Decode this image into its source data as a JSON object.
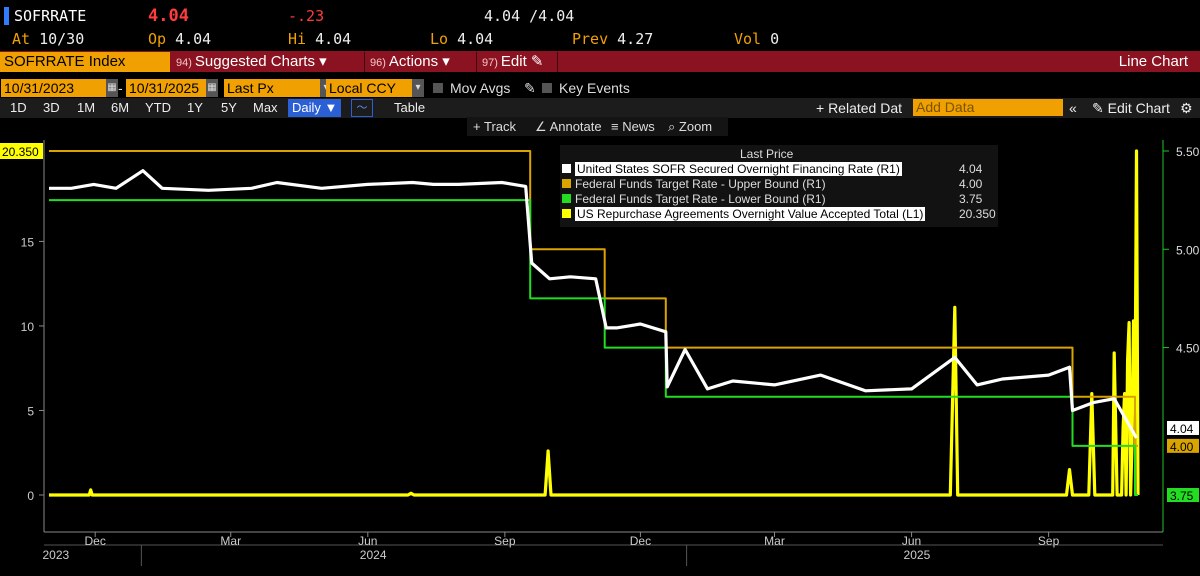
{
  "quote": {
    "ticker": "SOFRRATE",
    "last": "4.04",
    "change": "-.23",
    "bid_ask": "4.04 /4.04",
    "at_label": "At",
    "at_value": "10/30",
    "open_label": "Op",
    "open_value": "4.04",
    "high_label": "Hi",
    "high_value": "4.04",
    "low_label": "Lo",
    "low_value": "4.04",
    "prev_label": "Prev",
    "prev_value": "4.27",
    "vol_label": "Vol",
    "vol_value": "0"
  },
  "menu": {
    "title": "SOFRRATE Index",
    "items": [
      {
        "num": "94)",
        "label": "Suggested Charts ▾"
      },
      {
        "num": "96)",
        "label": "Actions ▾"
      },
      {
        "num": "97)",
        "label": "Edit ✎"
      }
    ],
    "right": "Line Chart"
  },
  "range": {
    "start": "10/31/2023",
    "dash": "-",
    "end": "10/31/2025",
    "field": "Last Px",
    "currency": "Local CCY",
    "mov_avgs": "Mov Avgs",
    "key_events": "Key Events"
  },
  "periods": [
    "1D",
    "3D",
    "1M",
    "6M",
    "YTD",
    "1Y",
    "5Y",
    "Max"
  ],
  "frequency": "Daily ▼",
  "table_btn": "Table",
  "related_data": "+ Related Dat",
  "add_data_placeholder": "Add Data",
  "edit_chart": "✎ Edit Chart",
  "tools": [
    "Track",
    "Annotate",
    "News",
    "Zoom"
  ],
  "colors": {
    "sofr": "#ffffff",
    "upper": "#d9a400",
    "lower": "#22dd22",
    "repo": "#ffff00",
    "accent": "#f0a000",
    "menu_bg": "#8b1220"
  },
  "chart_data": {
    "type": "line",
    "legend_title": "Last Price",
    "legend_position": "top-center",
    "series": [
      {
        "name": "United States SOFR Secured Overnight Financing Rate  (R1)",
        "axis": "right",
        "last_label": "4.04",
        "points": [
          [
            "2023-10-31",
            5.31
          ],
          [
            "2023-11-15",
            5.31
          ],
          [
            "2023-11-30",
            5.33
          ],
          [
            "2023-12-15",
            5.31
          ],
          [
            "2024-01-02",
            5.4
          ],
          [
            "2024-01-15",
            5.31
          ],
          [
            "2024-02-15",
            5.3
          ],
          [
            "2024-03-15",
            5.31
          ],
          [
            "2024-04-01",
            5.34
          ],
          [
            "2024-05-01",
            5.31
          ],
          [
            "2024-06-01",
            5.33
          ],
          [
            "2024-07-01",
            5.34
          ],
          [
            "2024-07-15",
            5.33
          ],
          [
            "2024-08-01",
            5.33
          ],
          [
            "2024-08-30",
            5.34
          ],
          [
            "2024-09-15",
            5.32
          ],
          [
            "2024-09-19",
            4.93
          ],
          [
            "2024-10-01",
            4.85
          ],
          [
            "2024-10-15",
            4.86
          ],
          [
            "2024-11-01",
            4.85
          ],
          [
            "2024-11-08",
            4.6
          ],
          [
            "2024-11-15",
            4.6
          ],
          [
            "2024-12-01",
            4.62
          ],
          [
            "2024-12-18",
            4.58
          ],
          [
            "2024-12-19",
            4.3
          ],
          [
            "2024-12-31",
            4.49
          ],
          [
            "2025-01-15",
            4.29
          ],
          [
            "2025-02-01",
            4.33
          ],
          [
            "2025-03-01",
            4.31
          ],
          [
            "2025-04-01",
            4.36
          ],
          [
            "2025-05-01",
            4.28
          ],
          [
            "2025-06-01",
            4.29
          ],
          [
            "2025-06-30",
            4.45
          ],
          [
            "2025-07-15",
            4.31
          ],
          [
            "2025-08-01",
            4.34
          ],
          [
            "2025-09-01",
            4.36
          ],
          [
            "2025-09-15",
            4.4
          ],
          [
            "2025-09-17",
            4.18
          ],
          [
            "2025-10-01",
            4.22
          ],
          [
            "2025-10-15",
            4.24
          ],
          [
            "2025-10-30",
            4.04
          ]
        ]
      },
      {
        "name": "Federal Funds Target Rate - Upper Bound  (R1)",
        "axis": "right",
        "last_label": "4.00",
        "points": [
          [
            "2023-10-31",
            5.5
          ],
          [
            "2024-09-18",
            5.5
          ],
          [
            "2024-09-18",
            5.0
          ],
          [
            "2024-11-07",
            5.0
          ],
          [
            "2024-11-07",
            4.75
          ],
          [
            "2024-12-18",
            4.75
          ],
          [
            "2024-12-18",
            4.5
          ],
          [
            "2025-09-17",
            4.5
          ],
          [
            "2025-09-17",
            4.25
          ],
          [
            "2025-10-29",
            4.25
          ],
          [
            "2025-10-29",
            4.0
          ],
          [
            "2025-10-31",
            4.0
          ]
        ]
      },
      {
        "name": "Federal Funds Target Rate - Lower Bound  (R1)",
        "axis": "right",
        "last_label": "3.75",
        "points": [
          [
            "2023-10-31",
            5.25
          ],
          [
            "2024-09-18",
            5.25
          ],
          [
            "2024-09-18",
            4.75
          ],
          [
            "2024-11-07",
            4.75
          ],
          [
            "2024-11-07",
            4.5
          ],
          [
            "2024-12-18",
            4.5
          ],
          [
            "2024-12-18",
            4.25
          ],
          [
            "2025-09-17",
            4.25
          ],
          [
            "2025-09-17",
            4.0
          ],
          [
            "2025-10-29",
            4.0
          ],
          [
            "2025-10-29",
            3.75
          ],
          [
            "2025-10-31",
            3.75
          ]
        ]
      },
      {
        "name": "US Repurchase Agreements Overnight Value Accepted Total  (L1)",
        "axis": "left",
        "last_label": "20.350",
        "points": [
          [
            "2023-10-31",
            0
          ],
          [
            "2023-11-27",
            0
          ],
          [
            "2023-11-28",
            0.3
          ],
          [
            "2023-11-29",
            0
          ],
          [
            "2024-06-28",
            0
          ],
          [
            "2024-06-30",
            0.1
          ],
          [
            "2024-07-02",
            0
          ],
          [
            "2024-09-28",
            0
          ],
          [
            "2024-09-30",
            2.6
          ],
          [
            "2024-10-02",
            0
          ],
          [
            "2025-06-27",
            0
          ],
          [
            "2025-06-30",
            11.1
          ],
          [
            "2025-07-02",
            0
          ],
          [
            "2025-09-13",
            0
          ],
          [
            "2025-09-15",
            1.5
          ],
          [
            "2025-09-17",
            0
          ],
          [
            "2025-09-28",
            0
          ],
          [
            "2025-09-30",
            6.0
          ],
          [
            "2025-10-02",
            0
          ],
          [
            "2025-10-14",
            0
          ],
          [
            "2025-10-15",
            8.4
          ],
          [
            "2025-10-17",
            0
          ],
          [
            "2025-10-20",
            0
          ],
          [
            "2025-10-21",
            4.0
          ],
          [
            "2025-10-22",
            6.0
          ],
          [
            "2025-10-23",
            0
          ],
          [
            "2025-10-24",
            8.0
          ],
          [
            "2025-10-25",
            10.2
          ],
          [
            "2025-10-26",
            0
          ],
          [
            "2025-10-27",
            3.0
          ],
          [
            "2025-10-28",
            10.3
          ],
          [
            "2025-10-29",
            5.0
          ],
          [
            "2025-10-30",
            20.35
          ],
          [
            "2025-10-31",
            0
          ]
        ]
      }
    ],
    "left_axis": {
      "ticks": [
        0,
        5,
        10,
        15
      ],
      "range": [
        0,
        20.35
      ],
      "last_label": "20.350"
    },
    "right_axis": {
      "ticks": [
        "5.50",
        "5.00",
        "4.50"
      ],
      "range": [
        3.75,
        5.5
      ]
    },
    "x_axis": {
      "range": [
        "2023-10-31",
        "2025-10-31"
      ],
      "months": [
        [
          "Dec",
          "2023-12-01"
        ],
        [
          "Mar",
          "2024-03-01"
        ],
        [
          "Jun",
          "2024-06-01"
        ],
        [
          "Sep",
          "2024-09-01"
        ],
        [
          "Dec",
          "2024-12-01"
        ],
        [
          "Mar",
          "2025-03-01"
        ],
        [
          "Jun",
          "2025-06-01"
        ],
        [
          "Sep",
          "2025-09-01"
        ]
      ],
      "years": [
        [
          "2023",
          "2023-11-01"
        ],
        [
          "2024",
          "2024-06-01"
        ],
        [
          "2025",
          "2025-06-01"
        ]
      ]
    },
    "grid": false
  }
}
